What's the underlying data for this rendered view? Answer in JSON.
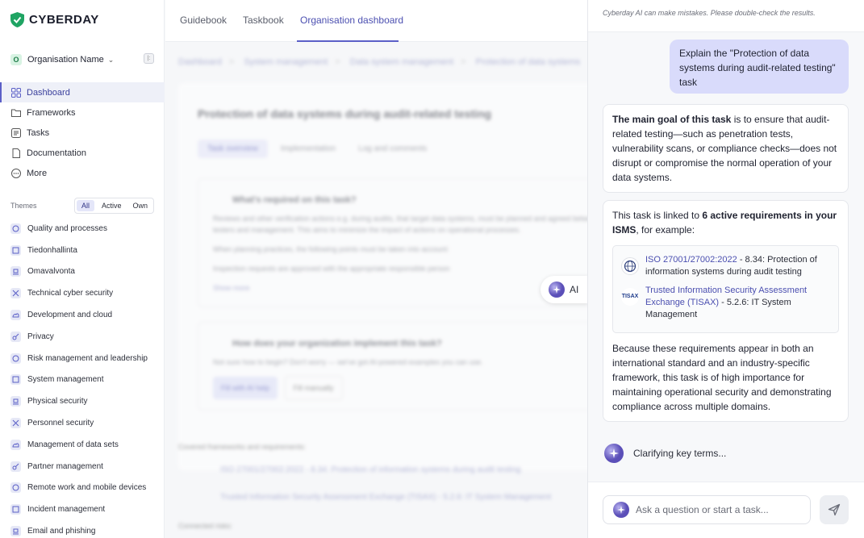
{
  "brand": {
    "name": "CYBERDAY"
  },
  "org": {
    "badge": "O",
    "name": "Organisation Name",
    "collapse": "|:"
  },
  "nav": [
    {
      "label": "Dashboard",
      "icon": "grid-icon",
      "active": true
    },
    {
      "label": "Frameworks",
      "icon": "folder-icon"
    },
    {
      "label": "Tasks",
      "icon": "task-list-icon"
    },
    {
      "label": "Documentation",
      "icon": "document-icon"
    },
    {
      "label": "More",
      "icon": "more-icon"
    }
  ],
  "themes": {
    "label": "Themes",
    "filters": [
      "All",
      "Active",
      "Own"
    ],
    "selected_filter": "All",
    "items": [
      "Quality and processes",
      "Tiedonhallinta",
      "Omavalvonta",
      "Technical cyber security",
      "Development and cloud",
      "Privacy",
      "Risk management and leadership",
      "System management",
      "Physical security",
      "Personnel security",
      "Management of data sets",
      "Partner management",
      "Remote work and mobile devices",
      "Incident management",
      "Email and phishing"
    ]
  },
  "top_tabs": [
    "Guidebook",
    "Taskbook",
    "Organisation dashboard"
  ],
  "active_top_tab": "Organisation dashboard",
  "main": {
    "breadcrumbs": [
      "Dashboard",
      "System management",
      "Data system management",
      "Protection of data systems"
    ],
    "title": "Protection of data systems during audit-related testing",
    "tabs": [
      "Task overview",
      "Implementation",
      "Log and comments"
    ],
    "required_heading": "What's required on this task?",
    "required_text_1": "Reviews and other verification actions e.g. during audits, that target data systems, must be planned and agreed between testers and management. This aims to minimize the impact of actions on operational processes.",
    "required_text_2": "When planning practices, the following points must be taken into account:",
    "required_bullet": "Inspection requests are approved with the appropriate responsible person",
    "show_more": "Show more",
    "implement_heading": "How does your organization implement this task?",
    "implement_text": "Not sure how to begin? Don't worry — we've got AI-powered examples you can use.",
    "fill_ai": "Fill with AI help",
    "fill_manual": "Fill manually",
    "covered_label": "Covered frameworks and requirements:",
    "covered_1": "ISO 27001/27002:2022 - 8.34: Protection of information systems during audit testing",
    "covered_2": "Trusted Information Security Assessment Exchange (TISAX) - 5.2.6: IT System Management",
    "risks_label": "Connected risks:"
  },
  "ai_button": {
    "label": "AI"
  },
  "chat": {
    "disclaimer": "Cyberday AI can make mistakes. Please double-check the results.",
    "user_message": "Explain the \"Protection of data systems during audit-related testing\" task",
    "reply1": {
      "bold": "The main goal of this task",
      "text": " is to ensure that audit-related testing—such as penetration tests, vulnerability scans, or compliance checks—does not disrupt or compromise the normal operation of your data systems."
    },
    "reply2": {
      "intro": "This task is linked to ",
      "intro_bold": "6 active requirements in your ISMS",
      "intro_end": ", for example:",
      "requirements": [
        {
          "logo": "iso-logo",
          "link": "ISO 27001/27002:2022",
          "rest": " - 8.34: Protection of information systems during audit testing"
        },
        {
          "logo": "tisax-logo",
          "logo_text": "TISAX",
          "link": "Trusted Information Security Assessment Exchange (TISAX)",
          "rest": " - 5.2.6: IT System Management"
        }
      ],
      "conclusion": "Because these requirements appear in both an international standard and an industry-specific framework, this task is of high importance for maintaining operational security and demonstrating compliance across multiple domains."
    },
    "status": "Clarifying key terms...",
    "input_placeholder": "Ask a question or start a task..."
  },
  "colors": {
    "accent": "#5b5fc7",
    "user_bubble": "#d9dbfb",
    "brand_green": "#1fa463"
  }
}
